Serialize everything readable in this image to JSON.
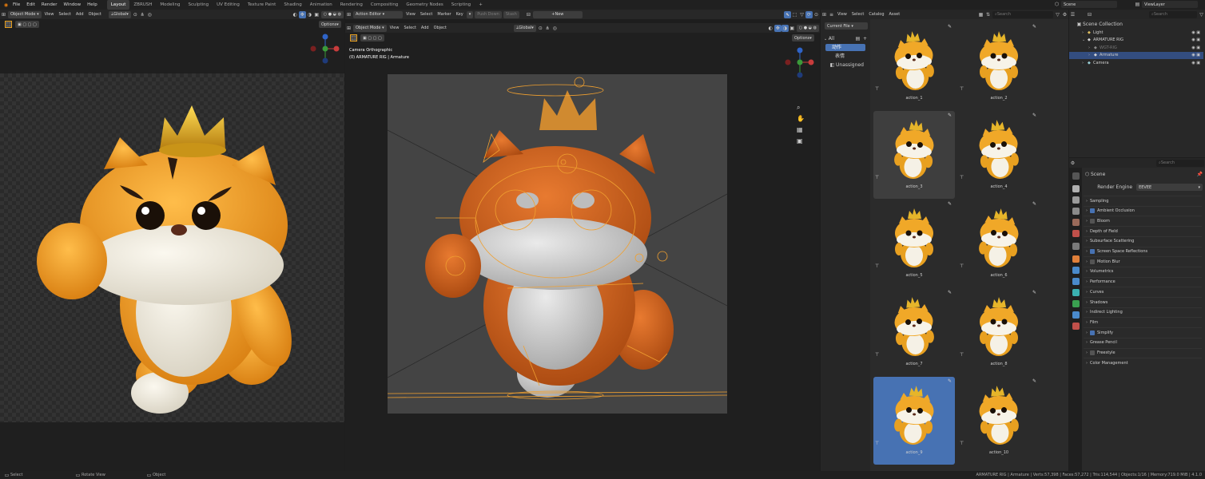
{
  "menu": [
    "File",
    "Edit",
    "Render",
    "Window",
    "Help"
  ],
  "workspaces": [
    "Layout",
    "ZBRUSH",
    "Modeling",
    "Sculpting",
    "UV Editing",
    "Texture Paint",
    "Shading",
    "Animation",
    "Rendering",
    "Compositing",
    "Geometry Nodes",
    "Scripting"
  ],
  "scene": {
    "label": "Scene",
    "viewlayer": "ViewLayer"
  },
  "left_viewport": {
    "mode": "Object Mode",
    "menus": [
      "View",
      "Select",
      "Add",
      "Object"
    ],
    "orientation": "Global",
    "options": "Options"
  },
  "action_editor": {
    "mode": "Action Editor",
    "menus": [
      "View",
      "Select",
      "Marker",
      "Key"
    ],
    "push_down": "Push Down",
    "stash": "Stash",
    "new_label": "New"
  },
  "center_viewport": {
    "mode": "Object Mode",
    "menus": [
      "View",
      "Select",
      "Add",
      "Object"
    ],
    "orientation": "Global",
    "options": "Options",
    "camera_text": "Camera Orthographic",
    "object_text": "(0) ARMATURE RIG | Armature"
  },
  "asset_browser": {
    "menus": [
      "View",
      "Select",
      "Catalog",
      "Asset"
    ],
    "search_placeholder": "Search",
    "library": "Current File",
    "catalog_all": "All",
    "catalog_items": [
      "动作",
      "表情",
      "Unassigned"
    ],
    "assets": [
      "action_1",
      "action_2",
      "action_3",
      "action_4",
      "action_5",
      "action_6",
      "action_7",
      "action_8",
      "action_9",
      "action_10"
    ],
    "selected_index": 8,
    "hover_index": 2
  },
  "outliner": {
    "search_placeholder": "Search",
    "root": "Scene Collection",
    "items": [
      {
        "label": "Light",
        "indent": 1
      },
      {
        "label": "ARMATURE RIG",
        "indent": 1
      },
      {
        "label": "WGT-RIG",
        "indent": 2
      },
      {
        "label": "Armature",
        "indent": 2,
        "selected": true
      },
      {
        "label": "Camera",
        "indent": 1
      }
    ]
  },
  "properties": {
    "search_placeholder": "Search",
    "scene": "Scene",
    "render_engine_label": "Render Engine",
    "render_engine_value": "EEVEE",
    "panels": [
      {
        "label": "Sampling",
        "checkbox": null
      },
      {
        "label": "Ambient Occlusion",
        "checkbox": true
      },
      {
        "label": "Bloom",
        "checkbox": false
      },
      {
        "label": "Depth of Field",
        "checkbox": null
      },
      {
        "label": "Subsurface Scattering",
        "checkbox": null
      },
      {
        "label": "Screen Space Reflections",
        "checkbox": true
      },
      {
        "label": "Motion Blur",
        "checkbox": false
      },
      {
        "label": "Volumetrics",
        "checkbox": null
      },
      {
        "label": "Performance",
        "checkbox": null
      },
      {
        "label": "Curves",
        "checkbox": null
      },
      {
        "label": "Shadows",
        "checkbox": null
      },
      {
        "label": "Indirect Lighting",
        "checkbox": null
      },
      {
        "label": "Film",
        "checkbox": null
      },
      {
        "label": "Simplify",
        "checkbox": true
      },
      {
        "label": "Grease Pencil",
        "checkbox": null
      },
      {
        "label": "Freestyle",
        "checkbox": false
      },
      {
        "label": "Color Management",
        "checkbox": null
      }
    ]
  },
  "status_bar": {
    "left": [
      "Select",
      "Rotate View",
      "Object"
    ],
    "right": "ARMATURE RIG | Armature | Verts:57,398 | Faces:57,272 | Tris:114,544 | Objects:1/16 | Memory:719.0 MiB | 4.1.0"
  },
  "colors": {
    "accent": "#4772b3",
    "character_orange": "#e8a020",
    "bone_orange": "#f0a030"
  }
}
